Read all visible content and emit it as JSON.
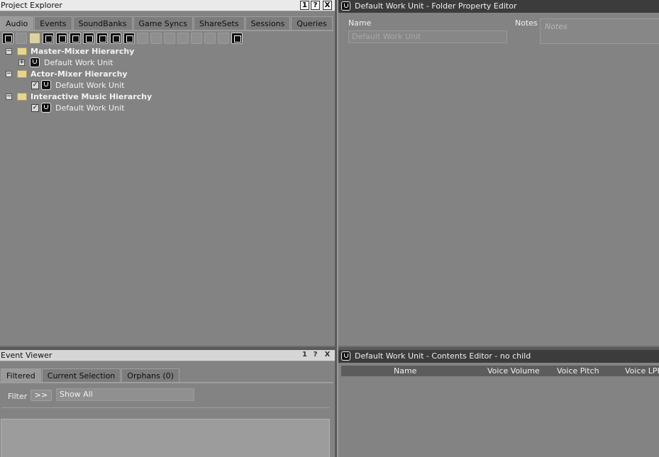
{
  "project_explorer": {
    "title": "Project Explorer",
    "window_buttons": [
      "1",
      "?",
      "X"
    ],
    "tabs": [
      "Audio",
      "Events",
      "SoundBanks",
      "Game Syncs",
      "ShareSets",
      "Sessions",
      "Queries"
    ],
    "active_tab": "Audio",
    "tree": [
      {
        "label": "Master-Mixer Hierarchy",
        "expanded": true
      },
      {
        "label": "Default Work Unit",
        "expanded": false
      },
      {
        "label": "Actor-Mixer Hierarchy",
        "expanded": true
      },
      {
        "label": "Default Work Unit",
        "checked": true
      },
      {
        "label": "Interactive Music Hierarchy",
        "expanded": true
      },
      {
        "label": "Default Work Unit",
        "checked": true
      }
    ]
  },
  "folder_property_editor": {
    "title": "Default Work Unit - Folder Property Editor",
    "name_label": "Name",
    "name_value": "Default Work Unit",
    "notes_label": "Notes",
    "notes_placeholder": "Notes"
  },
  "event_viewer": {
    "title": "Event Viewer",
    "window_buttons": [
      "1",
      "?",
      "X"
    ],
    "tabs": [
      "Filtered",
      "Current Selection",
      "Orphans (0)"
    ],
    "active_tab": "Filtered",
    "filter_label": "Filter",
    "filter_button": ">>",
    "filter_value": "Show All"
  },
  "contents_editor": {
    "title": "Default Work Unit - Contents Editor - no child",
    "columns": [
      "Name",
      "Voice Volume",
      "Voice Pitch",
      "Voice LPF"
    ]
  }
}
